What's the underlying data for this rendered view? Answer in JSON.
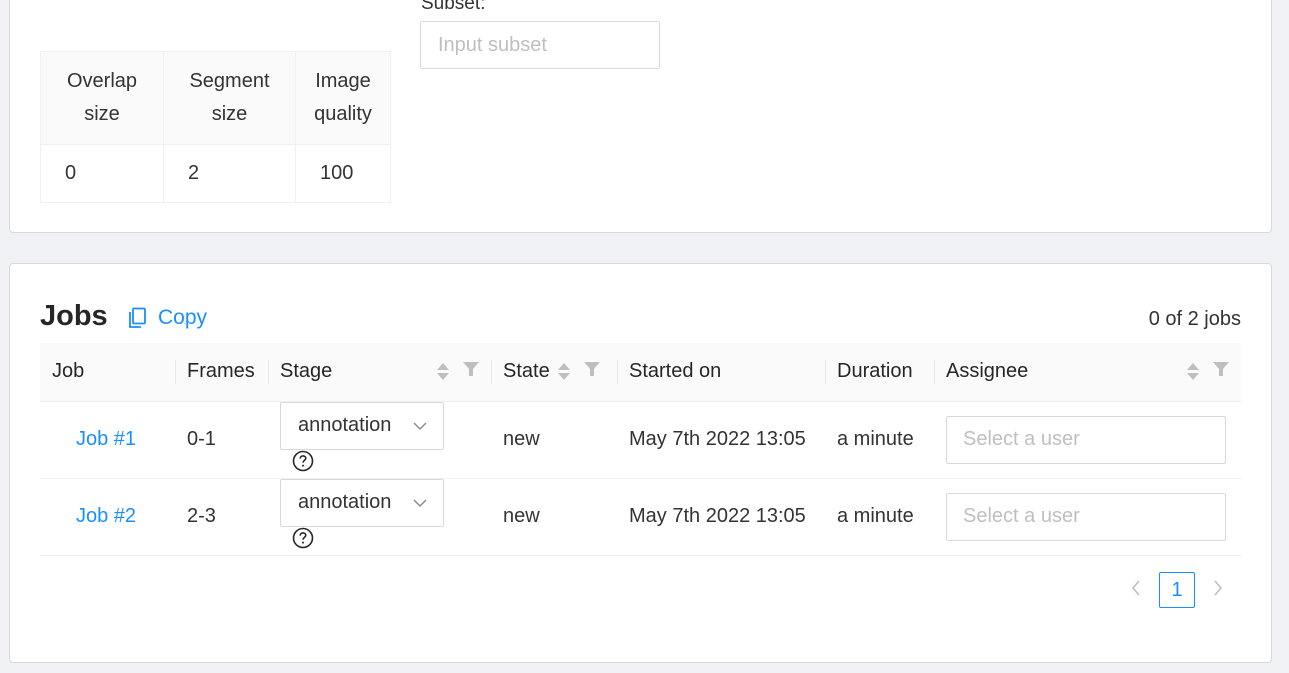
{
  "details": {
    "subset_label": "Subset:",
    "subset_placeholder": "Input subset",
    "headers": [
      "Overlap size",
      "Segment size",
      "Image quality"
    ],
    "values": [
      "0",
      "2",
      "100"
    ]
  },
  "jobs": {
    "title": "Jobs",
    "copy_label": "Copy",
    "count": "0 of 2 jobs",
    "columns": {
      "job": "Job",
      "frames": "Frames",
      "stage": "Stage",
      "state": "State",
      "started_on": "Started on",
      "duration": "Duration",
      "assignee": "Assignee"
    },
    "rows": [
      {
        "job": "Job #1",
        "frames": "0-1",
        "stage": "annotation",
        "state": "new",
        "started_on": "May 7th 2022 13:05",
        "duration": "a minute",
        "assignee_placeholder": "Select a user"
      },
      {
        "job": "Job #2",
        "frames": "2-3",
        "stage": "annotation",
        "state": "new",
        "started_on": "May 7th 2022 13:05",
        "duration": "a minute",
        "assignee_placeholder": "Select a user"
      }
    ]
  },
  "pagination": {
    "current_page": "1"
  },
  "colors": {
    "link": "#1890ff",
    "muted": "#a6a6a6",
    "border": "#d9d9d9"
  },
  "icons": {
    "copy": "copy-icon",
    "help": "question-circle-icon",
    "sort": "sort-icon",
    "filter": "filter-icon",
    "chevron": "chevron-down-icon"
  }
}
